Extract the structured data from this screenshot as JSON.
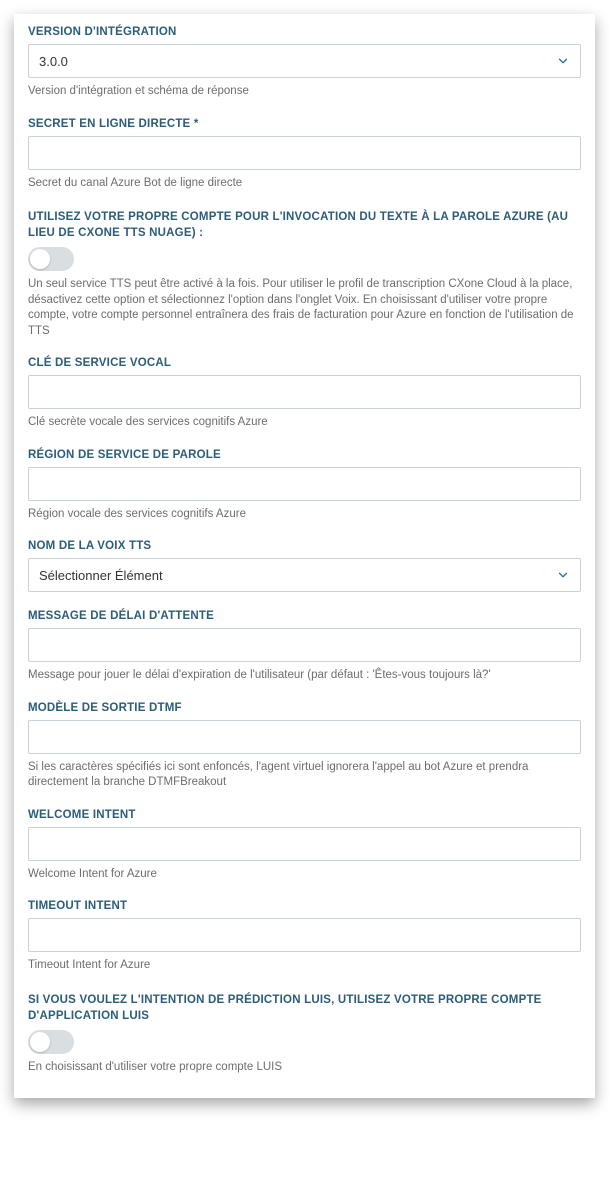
{
  "fields": {
    "version": {
      "label": "VERSION D'INTÉGRATION",
      "value": "3.0.0",
      "help": "Version d'intégration et schéma de réponse"
    },
    "directline_secret": {
      "label": "SECRET EN LIGNE DIRECTE *",
      "value": "",
      "help": "Secret du canal Azure Bot de ligne directe"
    },
    "use_own_azure_tts": {
      "label": "UTILISEZ VOTRE PROPRE COMPTE POUR L'INVOCATION DU TEXTE À LA PAROLE AZURE (AU LIEU DE CXONE TTS NUAGE) :",
      "help": "Un seul service TTS peut être activé à la fois. Pour utiliser le profil de transcription CXone Cloud à la place, désactivez cette option et sélectionnez l'option dans l'onglet Voix. En choisissant d'utiliser votre propre compte, votre compte personnel entraînera des frais de facturation pour Azure en fonction de l'utilisation de TTS"
    },
    "voice_service_key": {
      "label": "CLÉ DE SERVICE VOCAL",
      "value": "",
      "help": "Clé secrète vocale des services cognitifs Azure"
    },
    "speech_region": {
      "label": "RÉGION DE SERVICE DE PAROLE",
      "value": "",
      "help": "Région vocale des services cognitifs Azure"
    },
    "tts_voice_name": {
      "label": "NOM DE LA VOIX TTS",
      "value": "Sélectionner Élément"
    },
    "timeout_message": {
      "label": "MESSAGE DE DÉLAI D'ATTENTE",
      "value": "",
      "help": "Message pour jouer le délai d'expiration de l'utilisateur (par défaut : 'Êtes-vous toujours là?'"
    },
    "dtmf_model": {
      "label": "MODÈLE DE SORTIE DTMF",
      "value": "",
      "help": "Si les caractères spécifiés ici sont enfoncés, l'agent virtuel ignorera l'appel au bot Azure et prendra directement la branche DTMFBreakout"
    },
    "welcome_intent": {
      "label": "WELCOME INTENT",
      "value": "",
      "help": "Welcome Intent for Azure"
    },
    "timeout_intent": {
      "label": "TIMEOUT INTENT",
      "value": "",
      "help": "Timeout Intent for Azure"
    },
    "use_luis": {
      "label": "SI VOUS VOULEZ L'INTENTION DE PRÉDICTION LUIS, UTILISEZ VOTRE PROPRE COMPTE D'APPLICATION LUIS",
      "help": "En choisissant d'utiliser votre propre compte LUIS"
    }
  }
}
